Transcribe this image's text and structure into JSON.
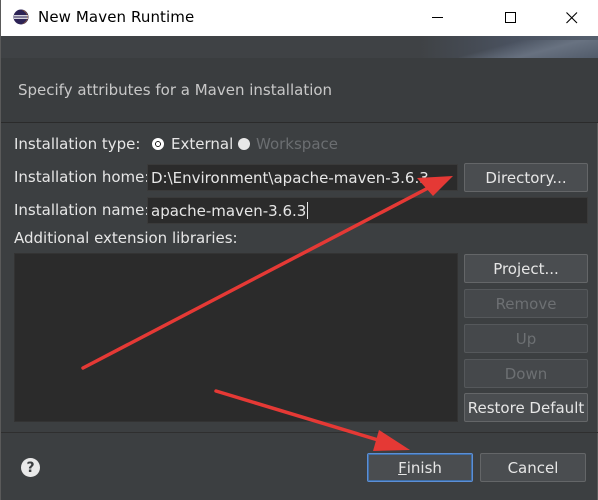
{
  "window": {
    "title": "New Maven Runtime"
  },
  "banner": {
    "message": "Specify attributes for a Maven installation"
  },
  "form": {
    "installation_type_label": "Installation type:",
    "radio_external_label": "External",
    "radio_workspace_label": "Workspace",
    "selected_type": "External",
    "installation_home_label": "Installation home:",
    "installation_home_value": "D:\\Environment\\apache-maven-3.6.3",
    "directory_button": "Directory...",
    "installation_name_label": "Installation name:",
    "installation_name_value": "apache-maven-3.6.3",
    "extension_libraries_label": "Additional extension libraries:"
  },
  "side_buttons": {
    "project": "Project...",
    "remove": "Remove",
    "up": "Up",
    "down": "Down",
    "restore_default": "Restore Default"
  },
  "footer": {
    "help_symbol": "?",
    "finish_mnemonic": "F",
    "finish_rest": "inish",
    "cancel": "Cancel"
  },
  "colors": {
    "dialog_bg": "#3c3f41",
    "field_bg": "#2b2b2b",
    "arrow": "#e53935"
  },
  "icons": [
    "eclipse-icon",
    "minimize-icon",
    "maximize-icon",
    "close-icon",
    "help-icon"
  ]
}
